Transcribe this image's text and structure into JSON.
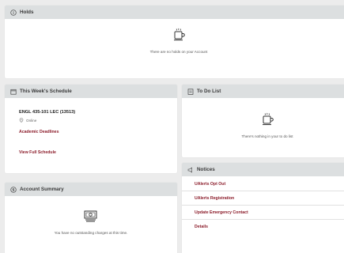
{
  "holds": {
    "title": "Holds",
    "empty_text": "There are no holds on your Account"
  },
  "schedule": {
    "title": "This Week's Schedule",
    "course": "ENGL 435-101 LEC (13513)",
    "location": "Online",
    "deadlines_link": "Academic Deadlines",
    "full_schedule_link": "View Full Schedule"
  },
  "todo": {
    "title": "To Do List",
    "empty_text": "There's nothing in your to do list"
  },
  "account": {
    "title": "Account Summary",
    "empty_text": "You have no outstanding charges at this time."
  },
  "notices": {
    "title": "Notices",
    "items": [
      {
        "label": "UAlerts Opt Out"
      },
      {
        "label": "UAlerts Registration"
      },
      {
        "label": "Update Emergency Contact"
      },
      {
        "label": "Details"
      }
    ]
  },
  "colors": {
    "link": "#8c1d2b",
    "header_bg": "#dcdfe0",
    "page_bg": "#ececec"
  }
}
